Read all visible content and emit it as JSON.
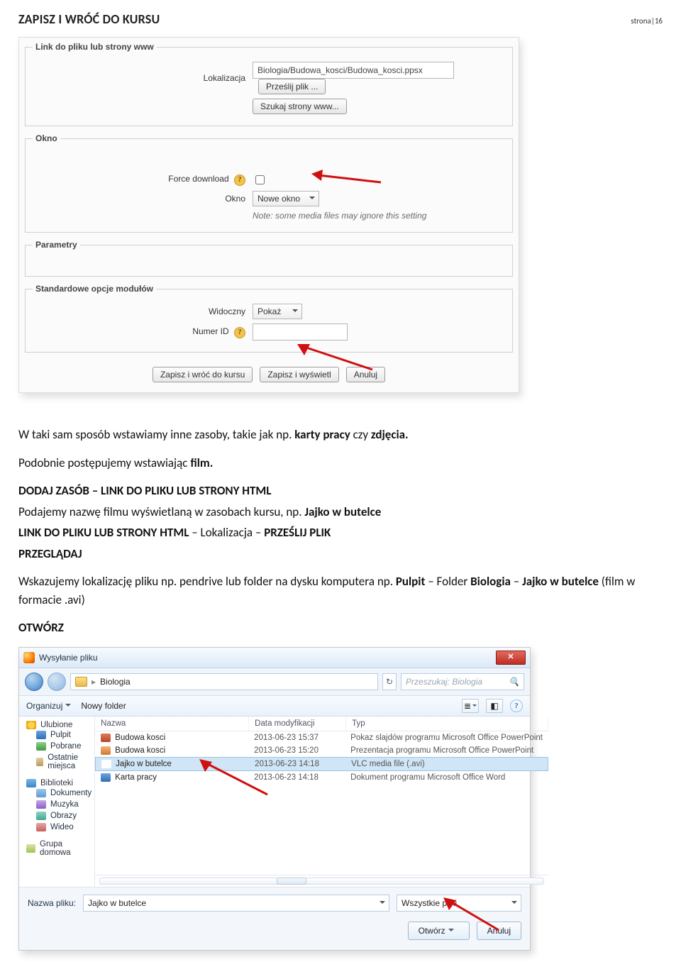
{
  "header": {
    "title": "ZAPISZ I WRÓĆ DO KURSU",
    "page_label": "strona|16"
  },
  "moodle": {
    "section_link": {
      "legend": "Link do pliku lub strony www",
      "loc_label": "Lokalizacja",
      "loc_value": "Biologia/Budowa_kosci/Budowa_kosci.ppsx",
      "upload_btn": "Prześlij plik ...",
      "search_btn": "Szukaj strony www..."
    },
    "section_window": {
      "legend": "Okno",
      "force_label": "Force download",
      "okno_label": "Okno",
      "okno_value": "Nowe okno",
      "note": "Note: some media files may ignore this setting"
    },
    "section_params": {
      "legend": "Parametry"
    },
    "section_std": {
      "legend": "Standardowe opcje modułów",
      "visible_label": "Widoczny",
      "visible_value": "Pokaż",
      "idnumber_label": "Numer ID"
    },
    "actions": {
      "save_return": "Zapisz i wróć do kursu",
      "save_display": "Zapisz i wyświetl",
      "cancel": "Anuluj"
    }
  },
  "prose": {
    "p1a": "W taki sam sposób wstawiamy inne zasoby, takie jak np. ",
    "p1b": "karty pracy",
    "p1c": " czy ",
    "p1d": "zdjęcia.",
    "p2a": "Podobnie postępujemy wstawiając ",
    "p2b": "film.",
    "h1": "DODAJ ZASÓB – LINK DO PLIKU LUB STRONY HTML",
    "p3a": "Podajemy nazwę filmu wyświetlaną w zasobach kursu, np. ",
    "p3b": "Jajko w butelce",
    "p4a": "LINK DO PLIKU LUB STRONY HTML",
    "p4b": " – Lokalizacja – ",
    "p4c": "PRZEŚLIJ PLIK",
    "p5": "PRZEGLĄDAJ",
    "p6a": "Wskazujemy lokalizację pliku np. pendrive lub folder na dysku komputera np. ",
    "p6b": "Pulpit",
    "p6c": " – Folder ",
    "p6d": "Biologia",
    "p6e": " – ",
    "p6f": "Jajko w butelce",
    "p6g": " (film w formacie .avi)",
    "p7": "OTWÓRZ"
  },
  "dialog": {
    "title": "Wysyłanie pliku",
    "breadcrumb": "Biologia",
    "search_placeholder": "Przeszukaj: Biologia",
    "toolbar": {
      "organize": "Organizuj",
      "newfolder": "Nowy folder"
    },
    "sidebar": {
      "fav": "Ulubione",
      "desktop": "Pulpit",
      "downloads": "Pobrane",
      "recent": "Ostatnie miejsca",
      "libs": "Biblioteki",
      "docs": "Dokumenty",
      "music": "Muzyka",
      "images": "Obrazy",
      "video": "Wideo",
      "homegroup": "Grupa domowa"
    },
    "columns": {
      "name": "Nazwa",
      "date": "Data modyfikacji",
      "type": "Typ"
    },
    "rows": [
      {
        "name": "Budowa kosci",
        "date": "2013-06-23 15:37",
        "type": "Pokaz slajdów programu Microsoft Office PowerPoint",
        "icon": "file-pps",
        "selected": false
      },
      {
        "name": "Budowa kosci",
        "date": "2013-06-23 15:20",
        "type": "Prezentacja programu Microsoft Office PowerPoint",
        "icon": "file-pp",
        "selected": false
      },
      {
        "name": "Jajko w butelce",
        "date": "2013-06-23 14:18",
        "type": "VLC media file (.avi)",
        "icon": "file-vlc",
        "selected": true
      },
      {
        "name": "Karta pracy",
        "date": "2013-06-23 14:18",
        "type": "Dokument programu Microsoft Office Word",
        "icon": "file-doc",
        "selected": false
      }
    ],
    "footer": {
      "filename_label": "Nazwa pliku:",
      "filename_value": "Jajko w butelce",
      "filter": "Wszystkie pliki",
      "open": "Otwórz",
      "cancel": "Anuluj"
    }
  }
}
